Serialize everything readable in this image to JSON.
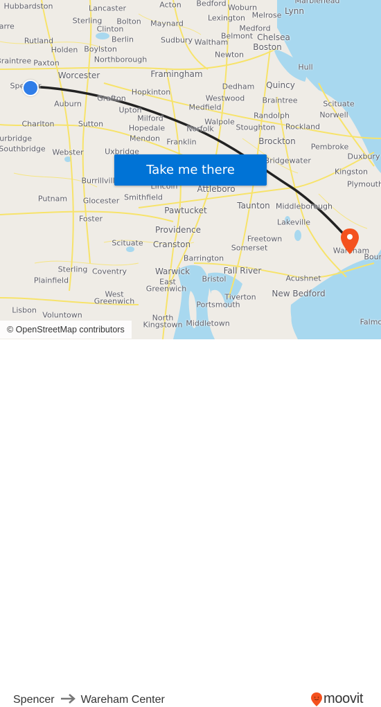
{
  "map": {
    "attribution": "© OpenStreetMap contributors",
    "cta_label": "Take me there",
    "colors": {
      "land": "#efece6",
      "water": "#a8d8ef",
      "roads": "#f7e36a",
      "route_line": "#222222",
      "origin": "#2f7de8",
      "destination": "#f4511e",
      "cta": "#0073d6"
    },
    "places": [
      {
        "name": "Hubbardston",
        "size": "s"
      },
      {
        "name": "Lancaster",
        "size": "s"
      },
      {
        "name": "Acton",
        "size": "s"
      },
      {
        "name": "Bedford",
        "size": "s"
      },
      {
        "name": "Woburn",
        "size": "s"
      },
      {
        "name": "Marblehead",
        "size": "s"
      },
      {
        "name": "Lynn",
        "size": "m"
      },
      {
        "name": "Sterling",
        "size": "s"
      },
      {
        "name": "Bolton",
        "size": "s"
      },
      {
        "name": "Maynard",
        "size": "s"
      },
      {
        "name": "Lexington",
        "size": "s"
      },
      {
        "name": "Melrose",
        "size": "s"
      },
      {
        "name": "Clinton",
        "size": "s"
      },
      {
        "name": "Barre",
        "size": "s"
      },
      {
        "name": "Rutland",
        "size": "s"
      },
      {
        "name": "Berlin",
        "size": "s"
      },
      {
        "name": "Sudbury",
        "size": "s"
      },
      {
        "name": "Medford",
        "size": "s"
      },
      {
        "name": "Belmont",
        "size": "s"
      },
      {
        "name": "Chelsea",
        "size": "m"
      },
      {
        "name": "Waltham",
        "size": "s"
      },
      {
        "name": "Holden",
        "size": "s"
      },
      {
        "name": "Boylston",
        "size": "s"
      },
      {
        "name": "Boston",
        "size": "m"
      },
      {
        "name": "New Braintree",
        "size": "s"
      },
      {
        "name": "Paxton",
        "size": "s"
      },
      {
        "name": "Northborough",
        "size": "s"
      },
      {
        "name": "Newton",
        "size": "s"
      },
      {
        "name": "Worcester",
        "size": "m"
      },
      {
        "name": "Framingham",
        "size": "m"
      },
      {
        "name": "Hull",
        "size": "s"
      },
      {
        "name": "Spencer",
        "size": "s"
      },
      {
        "name": "Hopkinton",
        "size": "s"
      },
      {
        "name": "Dedham",
        "size": "s"
      },
      {
        "name": "Quincy",
        "size": "m"
      },
      {
        "name": "Grafton",
        "size": "s"
      },
      {
        "name": "Westwood",
        "size": "s"
      },
      {
        "name": "Braintree",
        "size": "s"
      },
      {
        "name": "Scituate",
        "size": "s"
      },
      {
        "name": "Auburn",
        "size": "s"
      },
      {
        "name": "Upton",
        "size": "s"
      },
      {
        "name": "Medfield",
        "size": "s"
      },
      {
        "name": "Milford",
        "size": "s"
      },
      {
        "name": "Randolph",
        "size": "s"
      },
      {
        "name": "Norwell",
        "size": "s"
      },
      {
        "name": "Charlton",
        "size": "s"
      },
      {
        "name": "Sutton",
        "size": "s"
      },
      {
        "name": "Walpole",
        "size": "s"
      },
      {
        "name": "Hopedale",
        "size": "s"
      },
      {
        "name": "Norfolk",
        "size": "s"
      },
      {
        "name": "Stoughton",
        "size": "s"
      },
      {
        "name": "Rockland",
        "size": "s"
      },
      {
        "name": "Sturbridge",
        "size": "s"
      },
      {
        "name": "Mendon",
        "size": "s"
      },
      {
        "name": "Franklin",
        "size": "s"
      },
      {
        "name": "Brockton",
        "size": "m"
      },
      {
        "name": "Southbridge",
        "size": "s"
      },
      {
        "name": "Pembroke",
        "size": "s"
      },
      {
        "name": "Webster",
        "size": "s"
      },
      {
        "name": "Uxbridge",
        "size": "s"
      },
      {
        "name": "Duxbury",
        "size": "s"
      },
      {
        "name": "West Bridgewater",
        "size": "s"
      },
      {
        "name": "Kingston",
        "size": "s"
      },
      {
        "name": "Burrillville",
        "size": "s"
      },
      {
        "name": "Lincoln",
        "size": "s"
      },
      {
        "name": "Plymouth",
        "size": "s"
      },
      {
        "name": "Attleboro",
        "size": "m"
      },
      {
        "name": "Putnam",
        "size": "s"
      },
      {
        "name": "Glocester",
        "size": "s"
      },
      {
        "name": "Smithfield",
        "size": "s"
      },
      {
        "name": "Taunton",
        "size": "m"
      },
      {
        "name": "Middleborough",
        "size": "s"
      },
      {
        "name": "Pawtucket",
        "size": "m"
      },
      {
        "name": "Foster",
        "size": "s"
      },
      {
        "name": "Lakeville",
        "size": "s"
      },
      {
        "name": "Providence",
        "size": "m"
      },
      {
        "name": "Freetown",
        "size": "s"
      },
      {
        "name": "Scituate",
        "size": "s"
      },
      {
        "name": "Cranston",
        "size": "m"
      },
      {
        "name": "Somerset",
        "size": "s"
      },
      {
        "name": "Wareham",
        "size": "s"
      },
      {
        "name": "Bourne",
        "size": "s"
      },
      {
        "name": "Barrington",
        "size": "s"
      },
      {
        "name": "Sterling",
        "size": "s"
      },
      {
        "name": "Coventry",
        "size": "s"
      },
      {
        "name": "Warwick",
        "size": "m"
      },
      {
        "name": "Fall River",
        "size": "m"
      },
      {
        "name": "Plainfield",
        "size": "s"
      },
      {
        "name": "Bristol",
        "size": "s"
      },
      {
        "name": "Acushnet",
        "size": "s"
      },
      {
        "name": "East",
        "size": "s"
      },
      {
        "name": "Greenwich",
        "size": "s"
      },
      {
        "name": "New Bedford",
        "size": "m"
      },
      {
        "name": "West",
        "size": "s"
      },
      {
        "name": "Greenwich",
        "size": "s"
      },
      {
        "name": "Tiverton",
        "size": "s"
      },
      {
        "name": "Portsmouth",
        "size": "s"
      },
      {
        "name": "Lisbon",
        "size": "s"
      },
      {
        "name": "Voluntown",
        "size": "s"
      },
      {
        "name": "North",
        "size": "s"
      },
      {
        "name": "Kingstown",
        "size": "s"
      },
      {
        "name": "Middletown",
        "size": "s"
      },
      {
        "name": "Falmouth",
        "size": "s"
      }
    ]
  },
  "trip": {
    "origin": "Spencer",
    "destination": "Wareham Center",
    "arrow_icon": "arrow-right-icon"
  },
  "brand": {
    "name": "moovit",
    "color": "#f4511e"
  }
}
